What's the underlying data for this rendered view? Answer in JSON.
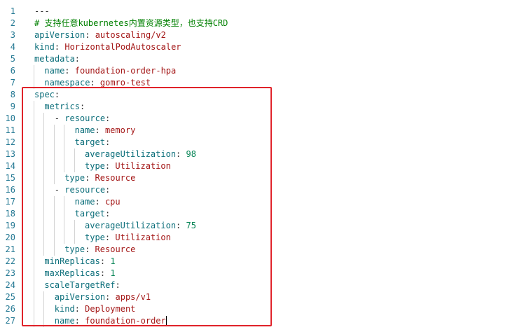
{
  "editor": {
    "lines": [
      {
        "n": "1",
        "indent": 0,
        "tokens": [
          {
            "t": "---",
            "c": "punct"
          }
        ]
      },
      {
        "n": "2",
        "indent": 0,
        "tokens": [
          {
            "t": "# 支持任意kubernetes内置资源类型，也支持CRD",
            "c": "cmt"
          }
        ]
      },
      {
        "n": "3",
        "indent": 0,
        "tokens": [
          {
            "t": "apiVersion",
            "c": "key"
          },
          {
            "t": ": ",
            "c": "punct"
          },
          {
            "t": "autoscaling/v2",
            "c": "str"
          }
        ]
      },
      {
        "n": "4",
        "indent": 0,
        "tokens": [
          {
            "t": "kind",
            "c": "key"
          },
          {
            "t": ": ",
            "c": "punct"
          },
          {
            "t": "HorizontalPodAutoscaler",
            "c": "str"
          }
        ]
      },
      {
        "n": "5",
        "indent": 0,
        "tokens": [
          {
            "t": "metadata",
            "c": "key"
          },
          {
            "t": ":",
            "c": "punct"
          }
        ]
      },
      {
        "n": "6",
        "indent": 1,
        "tokens": [
          {
            "t": "name",
            "c": "key"
          },
          {
            "t": ": ",
            "c": "punct"
          },
          {
            "t": "foundation-order-hpa",
            "c": "str"
          }
        ]
      },
      {
        "n": "7",
        "indent": 1,
        "tokens": [
          {
            "t": "namespace",
            "c": "key"
          },
          {
            "t": ": ",
            "c": "punct"
          },
          {
            "t": "gomro-test",
            "c": "str"
          }
        ]
      },
      {
        "n": "8",
        "indent": 0,
        "tokens": [
          {
            "t": "spec",
            "c": "key"
          },
          {
            "t": ":",
            "c": "punct"
          }
        ]
      },
      {
        "n": "9",
        "indent": 1,
        "tokens": [
          {
            "t": "metrics",
            "c": "key"
          },
          {
            "t": ":",
            "c": "punct"
          }
        ]
      },
      {
        "n": "10",
        "indent": 2,
        "tokens": [
          {
            "t": "- ",
            "c": "dash"
          },
          {
            "t": "resource",
            "c": "key"
          },
          {
            "t": ":",
            "c": "punct"
          }
        ]
      },
      {
        "n": "11",
        "indent": 4,
        "tokens": [
          {
            "t": "name",
            "c": "key"
          },
          {
            "t": ": ",
            "c": "punct"
          },
          {
            "t": "memory",
            "c": "str"
          }
        ]
      },
      {
        "n": "12",
        "indent": 4,
        "tokens": [
          {
            "t": "target",
            "c": "key"
          },
          {
            "t": ":",
            "c": "punct"
          }
        ]
      },
      {
        "n": "13",
        "indent": 5,
        "tokens": [
          {
            "t": "averageUtilization",
            "c": "key"
          },
          {
            "t": ": ",
            "c": "punct"
          },
          {
            "t": "98",
            "c": "num"
          }
        ]
      },
      {
        "n": "14",
        "indent": 5,
        "tokens": [
          {
            "t": "type",
            "c": "key"
          },
          {
            "t": ": ",
            "c": "punct"
          },
          {
            "t": "Utilization",
            "c": "str"
          }
        ]
      },
      {
        "n": "15",
        "indent": 3,
        "tokens": [
          {
            "t": "type",
            "c": "key"
          },
          {
            "t": ": ",
            "c": "punct"
          },
          {
            "t": "Resource",
            "c": "str"
          }
        ]
      },
      {
        "n": "16",
        "indent": 2,
        "tokens": [
          {
            "t": "- ",
            "c": "dash"
          },
          {
            "t": "resource",
            "c": "key"
          },
          {
            "t": ":",
            "c": "punct"
          }
        ]
      },
      {
        "n": "17",
        "indent": 4,
        "tokens": [
          {
            "t": "name",
            "c": "key"
          },
          {
            "t": ": ",
            "c": "punct"
          },
          {
            "t": "cpu",
            "c": "str"
          }
        ]
      },
      {
        "n": "18",
        "indent": 4,
        "tokens": [
          {
            "t": "target",
            "c": "key"
          },
          {
            "t": ":",
            "c": "punct"
          }
        ]
      },
      {
        "n": "19",
        "indent": 5,
        "tokens": [
          {
            "t": "averageUtilization",
            "c": "key"
          },
          {
            "t": ": ",
            "c": "punct"
          },
          {
            "t": "75",
            "c": "num"
          }
        ]
      },
      {
        "n": "20",
        "indent": 5,
        "tokens": [
          {
            "t": "type",
            "c": "key"
          },
          {
            "t": ": ",
            "c": "punct"
          },
          {
            "t": "Utilization",
            "c": "str"
          }
        ]
      },
      {
        "n": "21",
        "indent": 3,
        "tokens": [
          {
            "t": "type",
            "c": "key"
          },
          {
            "t": ": ",
            "c": "punct"
          },
          {
            "t": "Resource",
            "c": "str"
          }
        ]
      },
      {
        "n": "22",
        "indent": 1,
        "tokens": [
          {
            "t": "minReplicas",
            "c": "key"
          },
          {
            "t": ": ",
            "c": "punct"
          },
          {
            "t": "1",
            "c": "num"
          }
        ]
      },
      {
        "n": "23",
        "indent": 1,
        "tokens": [
          {
            "t": "maxReplicas",
            "c": "key"
          },
          {
            "t": ": ",
            "c": "punct"
          },
          {
            "t": "1",
            "c": "num"
          }
        ]
      },
      {
        "n": "24",
        "indent": 1,
        "tokens": [
          {
            "t": "scaleTargetRef",
            "c": "key"
          },
          {
            "t": ":",
            "c": "punct"
          }
        ]
      },
      {
        "n": "25",
        "indent": 2,
        "tokens": [
          {
            "t": "apiVersion",
            "c": "key"
          },
          {
            "t": ": ",
            "c": "punct"
          },
          {
            "t": "apps/v1",
            "c": "str"
          }
        ]
      },
      {
        "n": "26",
        "indent": 2,
        "tokens": [
          {
            "t": "kind",
            "c": "key"
          },
          {
            "t": ": ",
            "c": "punct"
          },
          {
            "t": "Deployment",
            "c": "str"
          }
        ]
      },
      {
        "n": "27",
        "indent": 2,
        "tokens": [
          {
            "t": "name",
            "c": "key"
          },
          {
            "t": ": ",
            "c": "punct"
          },
          {
            "t": "foundation-order",
            "c": "str"
          }
        ]
      }
    ]
  },
  "colors": {
    "line_number": "#237893",
    "key": "#0b6e7a",
    "string": "#a31515",
    "number": "#098658",
    "comment": "#008000",
    "highlight_border": "#e0232a"
  }
}
